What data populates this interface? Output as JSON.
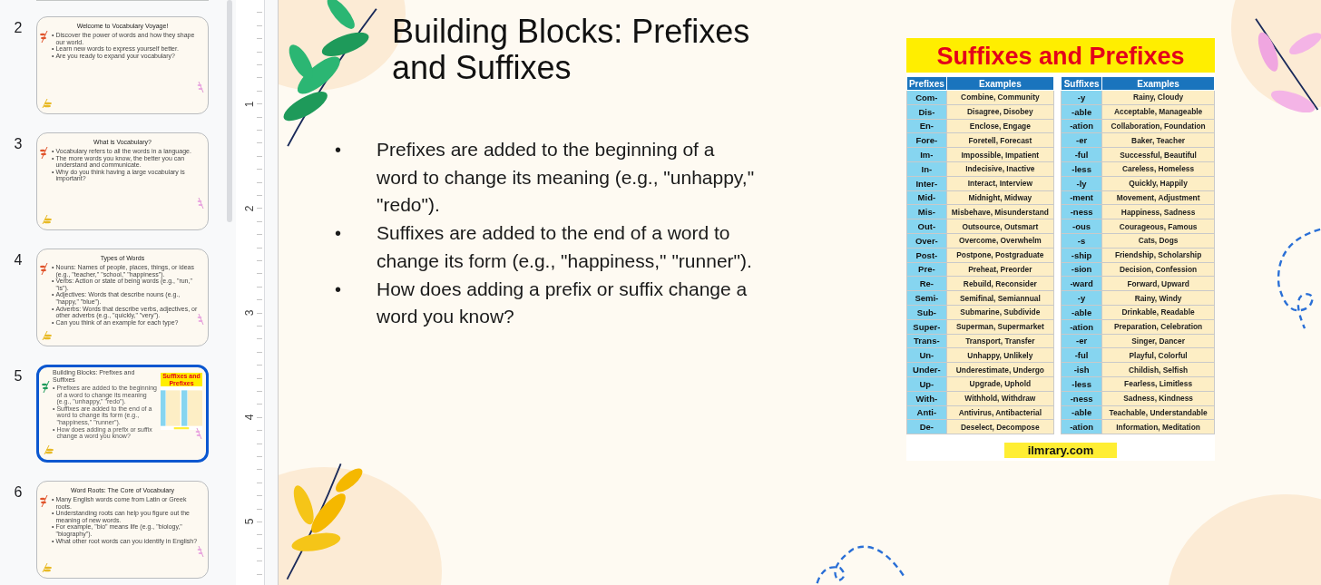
{
  "thumbnails": [
    {
      "number": "2",
      "kind": "text",
      "selected": false,
      "title": "Welcome to Vocabulary Voyage!",
      "bullets": [
        "Discover the power of words and how they shape our world.",
        "Learn new words to express yourself better.",
        "Are you ready to expand your vocabulary?"
      ]
    },
    {
      "number": "3",
      "kind": "text",
      "selected": false,
      "title": "What is Vocabulary?",
      "bullets": [
        "Vocabulary refers to all the words in a language.",
        "The more words you know, the better you can understand and communicate.",
        "Why do you think having a large vocabulary is important?"
      ]
    },
    {
      "number": "4",
      "kind": "text",
      "selected": false,
      "title": "Types of Words",
      "bullets": [
        "Nouns: Names of people, places, things, or ideas (e.g., \"teacher,\" \"school,\" \"happiness\").",
        "Verbs: Action or state of being words (e.g., \"run,\" \"is\").",
        "Adjectives: Words that describe nouns (e.g., \"happy,\" \"blue\").",
        "Adverbs: Words that describe verbs, adjectives, or other adverbs (e.g., \"quickly,\" \"very\").",
        "Can you think of an example for each type?"
      ]
    },
    {
      "number": "5",
      "kind": "table",
      "selected": true,
      "title": "Building Blocks: Prefixes and Suffixes",
      "bullets": [
        "Prefixes are added to the beginning of a word to change its meaning (e.g., \"unhappy,\" \"redo\").",
        "Suffixes are added to the end of a word to change its form (e.g., \"happiness,\" \"runner\").",
        "How does adding a prefix or suffix change a word you know?"
      ],
      "image_title": "Suffixes and Prefixes"
    },
    {
      "number": "6",
      "kind": "text",
      "selected": false,
      "title": "Word Roots: The Core of Vocabulary",
      "bullets": [
        "Many English words come from Latin or Greek roots.",
        "Understanding roots can help you figure out the meaning of new words.",
        "For example, \"bio\" means life (e.g., \"biology,\" \"biography\").",
        "What other root words can you identify in English?"
      ]
    }
  ],
  "bullet_marker": "•",
  "ruler": [
    "1",
    "2",
    "3",
    "4",
    "5"
  ],
  "slide": {
    "title": "Building Blocks: Prefixes and Suffixes",
    "bullets": [
      "Prefixes are added to the beginning of a word to change its meaning (e.g., \"unhappy,\" \"redo\").",
      "Suffixes are added to the end of a word to change its form (e.g., \"happiness,\" \"runner\").",
      "How does adding a prefix or suffix change a word you know?"
    ],
    "image": {
      "title": "Suffixes and Prefixes",
      "columns": [
        "Prefixes",
        "Examples",
        "Suffixes",
        "Examples"
      ],
      "footer": "ilmrary.com",
      "rows": [
        [
          "Com-",
          "Combine, Community",
          "-y",
          "Rainy, Cloudy"
        ],
        [
          "Dis-",
          "Disagree, Disobey",
          "-able",
          "Acceptable, Manageable"
        ],
        [
          "En-",
          "Enclose, Engage",
          "-ation",
          "Collaboration, Foundation"
        ],
        [
          "Fore-",
          "Foretell, Forecast",
          "-er",
          "Baker, Teacher"
        ],
        [
          "Im-",
          "Impossible, Impatient",
          "-ful",
          "Successful, Beautiful"
        ],
        [
          "In-",
          "Indecisive, Inactive",
          "-less",
          "Careless, Homeless"
        ],
        [
          "Inter-",
          "Interact, Interview",
          "-ly",
          "Quickly, Happily"
        ],
        [
          "Mid-",
          "Midnight, Midway",
          "-ment",
          "Movement, Adjustment"
        ],
        [
          "Mis-",
          "Misbehave, Misunderstand",
          "-ness",
          "Happiness, Sadness"
        ],
        [
          "Out-",
          "Outsource, Outsmart",
          "-ous",
          "Courageous, Famous"
        ],
        [
          "Over-",
          "Overcome, Overwhelm",
          "-s",
          "Cats, Dogs"
        ],
        [
          "Post-",
          "Postpone, Postgraduate",
          "-ship",
          "Friendship, Scholarship"
        ],
        [
          "Pre-",
          "Preheat, Preorder",
          "-sion",
          "Decision, Confession"
        ],
        [
          "Re-",
          "Rebuild, Reconsider",
          "-ward",
          "Forward, Upward"
        ],
        [
          "Semi-",
          "Semifinal, Semiannual",
          "-y",
          "Rainy, Windy"
        ],
        [
          "Sub-",
          "Submarine, Subdivide",
          "-able",
          "Drinkable, Readable"
        ],
        [
          "Super-",
          "Superman, Supermarket",
          "-ation",
          "Preparation, Celebration"
        ],
        [
          "Trans-",
          "Transport, Transfer",
          "-er",
          "Singer, Dancer"
        ],
        [
          "Un-",
          "Unhappy, Unlikely",
          "-ful",
          "Playful, Colorful"
        ],
        [
          "Under-",
          "Underestimate, Undergo",
          "-ish",
          "Childish, Selfish"
        ],
        [
          "Up-",
          "Upgrade, Uphold",
          "-less",
          "Fearless, Limitless"
        ],
        [
          "With-",
          "Withhold, Withdraw",
          "-ness",
          "Sadness, Kindness"
        ],
        [
          "Anti-",
          "Antivirus, Antibacterial",
          "-able",
          "Teachable, Understandable"
        ],
        [
          "De-",
          "Deselect, Decompose",
          "-ation",
          "Information, Meditation"
        ]
      ]
    }
  }
}
